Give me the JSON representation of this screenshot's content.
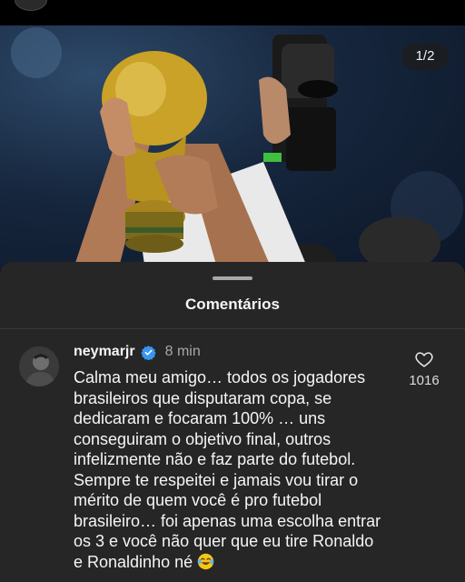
{
  "photo": {
    "counter": "1/2",
    "colors": {
      "bg": "#16263d",
      "trophy": "#c9a227",
      "sheet": "#262626"
    }
  },
  "comments_sheet": {
    "title": "Comentários",
    "comment": {
      "username": "neymarjr",
      "verified": true,
      "time": "8 min",
      "text": "Calma meu amigo… todos os jogadores brasileiros que disputaram copa, se dedicaram e focaram 100% … uns conseguiram o objetivo final, outros infelizmente não e faz parte do futebol. Sempre te respeitei e jamais vou tirar o mérito de quem você é pro futebol brasileiro… foi apenas uma escolha entrar os 3 e você não quer que eu tire Ronaldo e Ronaldinho né",
      "like_count": "1016"
    }
  },
  "icons": {
    "verified": "verified-badge-icon",
    "heart": "heart-outline-icon",
    "emoji": "laughing-tears-emoji"
  }
}
